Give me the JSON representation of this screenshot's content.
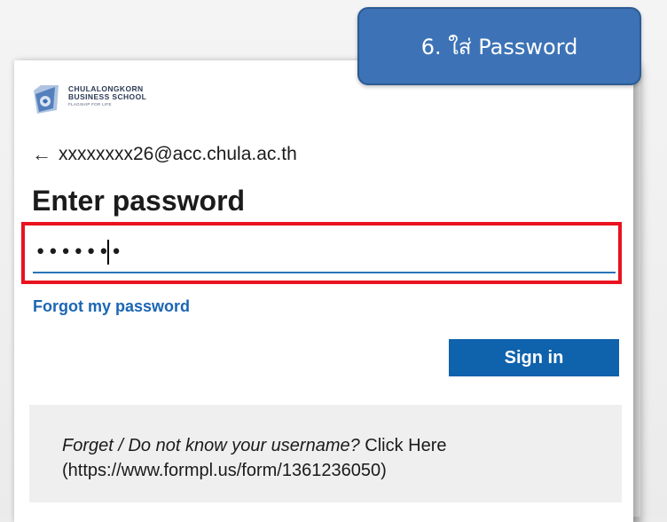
{
  "step_badge": {
    "label": "6. ใส่ Password",
    "color": "#3d73b6"
  },
  "logo": {
    "line1": "CHULALONGKORN",
    "line2": "BUSINESS SCHOOL",
    "line3": "FLAGSHIP FOR LIFE",
    "icon": "chula-business-school-crest"
  },
  "signin": {
    "back_arrow": "←",
    "account": "xxxxxxxx26@acc.chula.ac.th",
    "title": "Enter password",
    "password_value": "•••••••",
    "forgot_link": "Forgot my password",
    "signin_button": "Sign in",
    "accent_color": "#0f62ac",
    "highlight_color": "#e8131f"
  },
  "help": {
    "italic_text": "Forget / Do not know your username?",
    "link_text": "Click Here",
    "url_text": "(https://www.formpl.us/form/1361236050)"
  }
}
